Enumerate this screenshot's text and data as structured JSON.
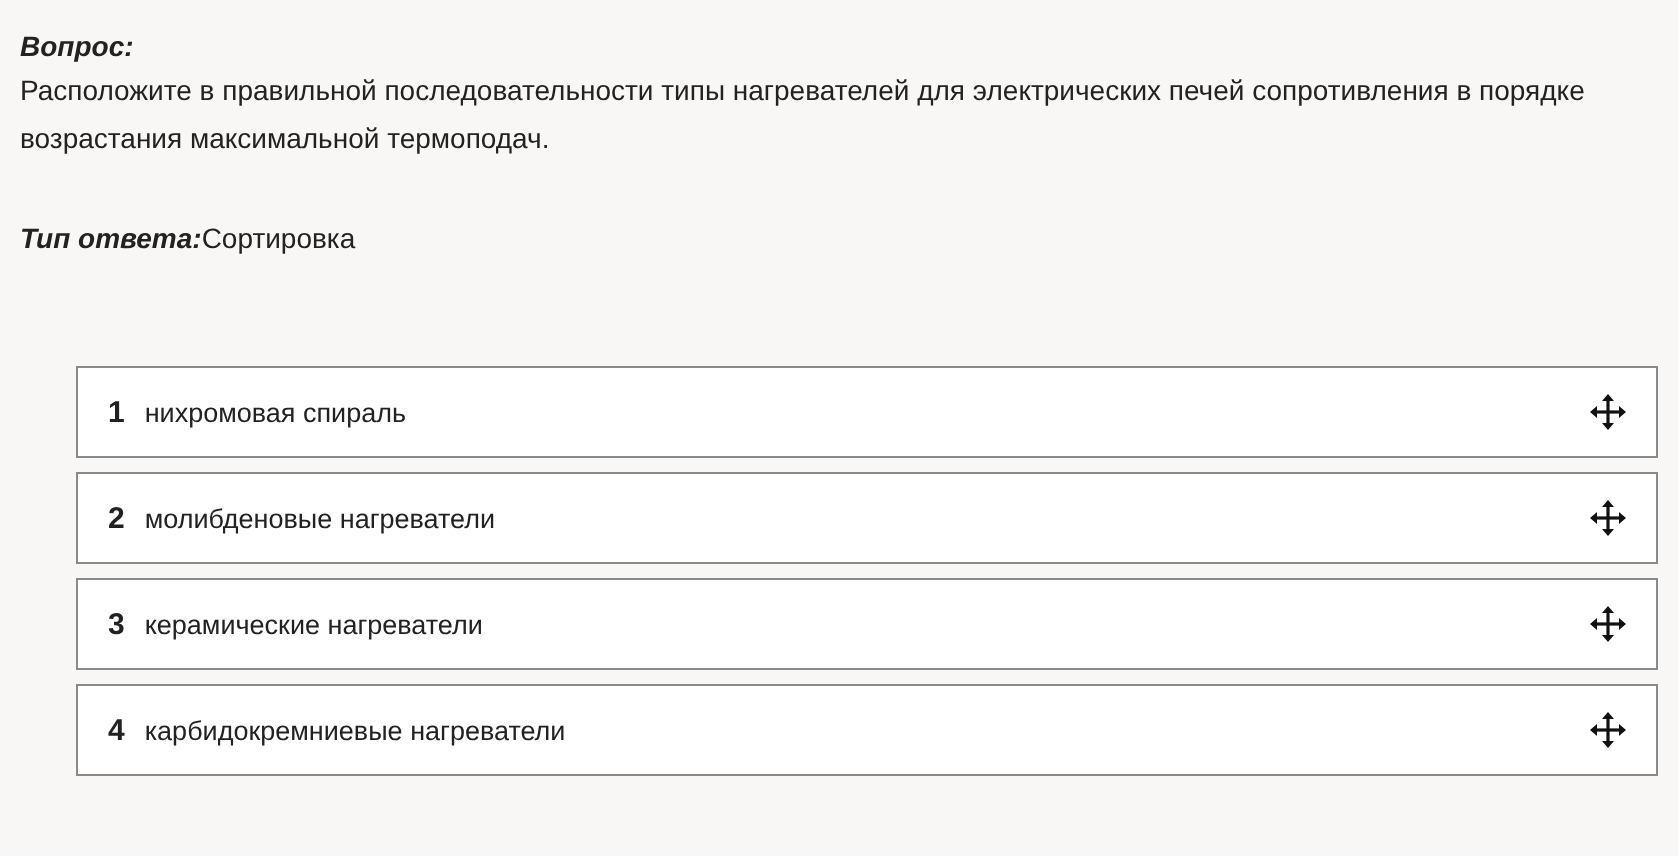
{
  "question": {
    "label": "Вопрос:",
    "text": "Расположите в правильной последовательности типы нагревателей для электрических печей сопротивления в порядке возрастания максимальной термоподач."
  },
  "answer_type": {
    "label": "Тип ответа:",
    "value": "Сортировка"
  },
  "items": [
    {
      "number": "1",
      "text": "нихромовая спираль"
    },
    {
      "number": "2",
      "text": "молибденовые нагреватели"
    },
    {
      "number": "3",
      "text": "керамические нагреватели"
    },
    {
      "number": "4",
      "text": "карбидокремниевые нагреватели"
    }
  ]
}
